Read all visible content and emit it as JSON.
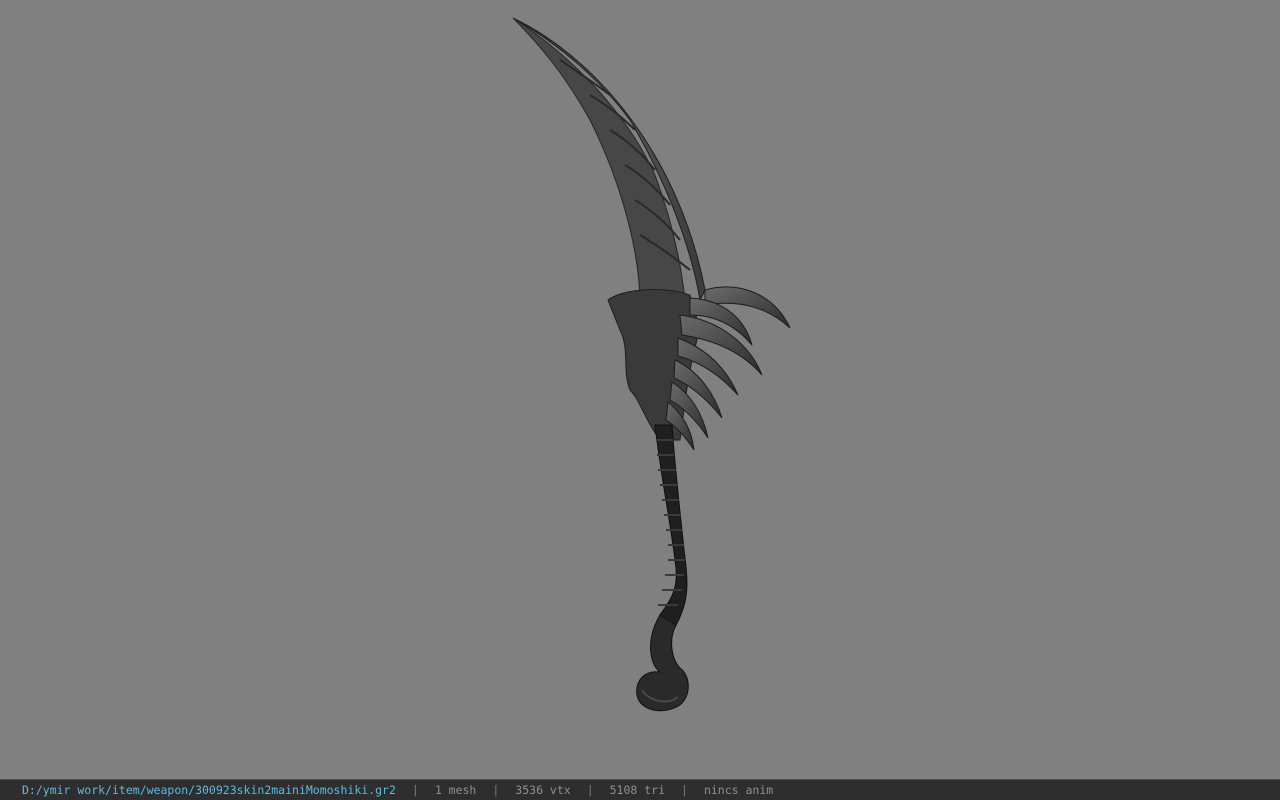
{
  "viewport": {
    "background_color": "#808080",
    "model_label": "weapon-model"
  },
  "statusbar": {
    "file_path": "D:/ymir work/item/weapon/300923skin2mainiMomoshiki.gr2",
    "separator": "|",
    "mesh_count": "1 mesh",
    "vertex_count": "3536 vtx",
    "triangle_count": "5108 tri",
    "animation_status": "nincs anim",
    "path_color": "#5fb9e0",
    "text_color": "#8f8f8f"
  }
}
